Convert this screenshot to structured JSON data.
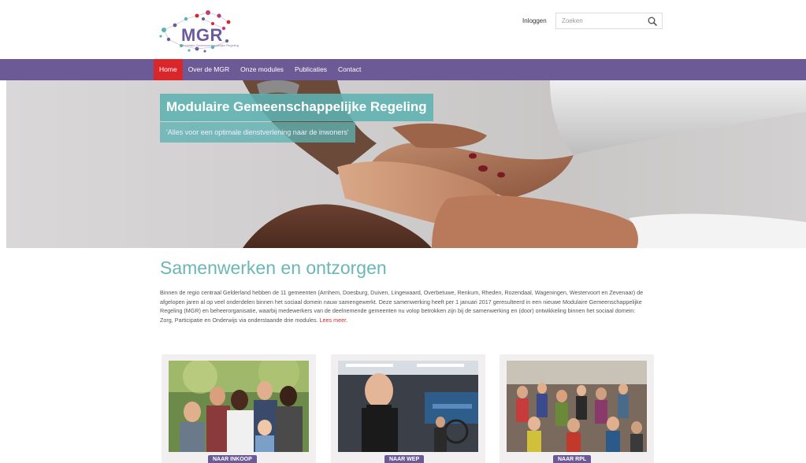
{
  "brand": {
    "logo_text": "MGR",
    "logo_subtext": "Modulaire Gemeenschappelijke Regeling",
    "accent_color": "#6c5a96",
    "teal_color": "#5db2b2",
    "active_color": "#d9262b"
  },
  "header": {
    "login_label": "Inloggen",
    "search_placeholder": "Zoeken",
    "search_icon": "search-icon"
  },
  "nav": {
    "items": [
      {
        "label": "Home",
        "active": true
      },
      {
        "label": "Over de MGR",
        "active": false
      },
      {
        "label": "Onze modules",
        "active": false
      },
      {
        "label": "Publicaties",
        "active": false
      },
      {
        "label": "Contact",
        "active": false
      }
    ]
  },
  "hero": {
    "title": "Modulaire Gemeenschappelijke Regeling",
    "subtitle": "'Alles voor een optimale dienstverlening naar de inwoners'"
  },
  "main": {
    "title": "Samenwerken en ontzorgen",
    "intro": "Binnen de regio centraal Gelderland hebben de 11 gemeenten (Arnhem, Doesburg, Duiven, Lingewaard, Overbetuwe, Renkum, Rheden, Rozendaal, Wageningen, Westervoort en Zevenaar) de afgelopen jaren al op veel onderdelen binnen het sociaal domein nauw samengewerkt. Deze samenwerking heeft per 1 januari 2017 geresulteerd in een nieuwe Modulaire Gemeenschappelijke Regeling (MGR) en beheerorganisatie, waarbij medewerkers van de deelnemende gemeenten nu volop betrokken zijn bij de samenwerking en (door) ontwikkeling binnen het sociaal domein: Zorg, Participatie en Onderwijs via onderstaande drie modules.",
    "read_more": "Lees meer."
  },
  "cards": [
    {
      "button_label": "NAAR INKOOP"
    },
    {
      "button_label": "NAAR WEP"
    },
    {
      "button_label": "NAAR RPL"
    }
  ]
}
